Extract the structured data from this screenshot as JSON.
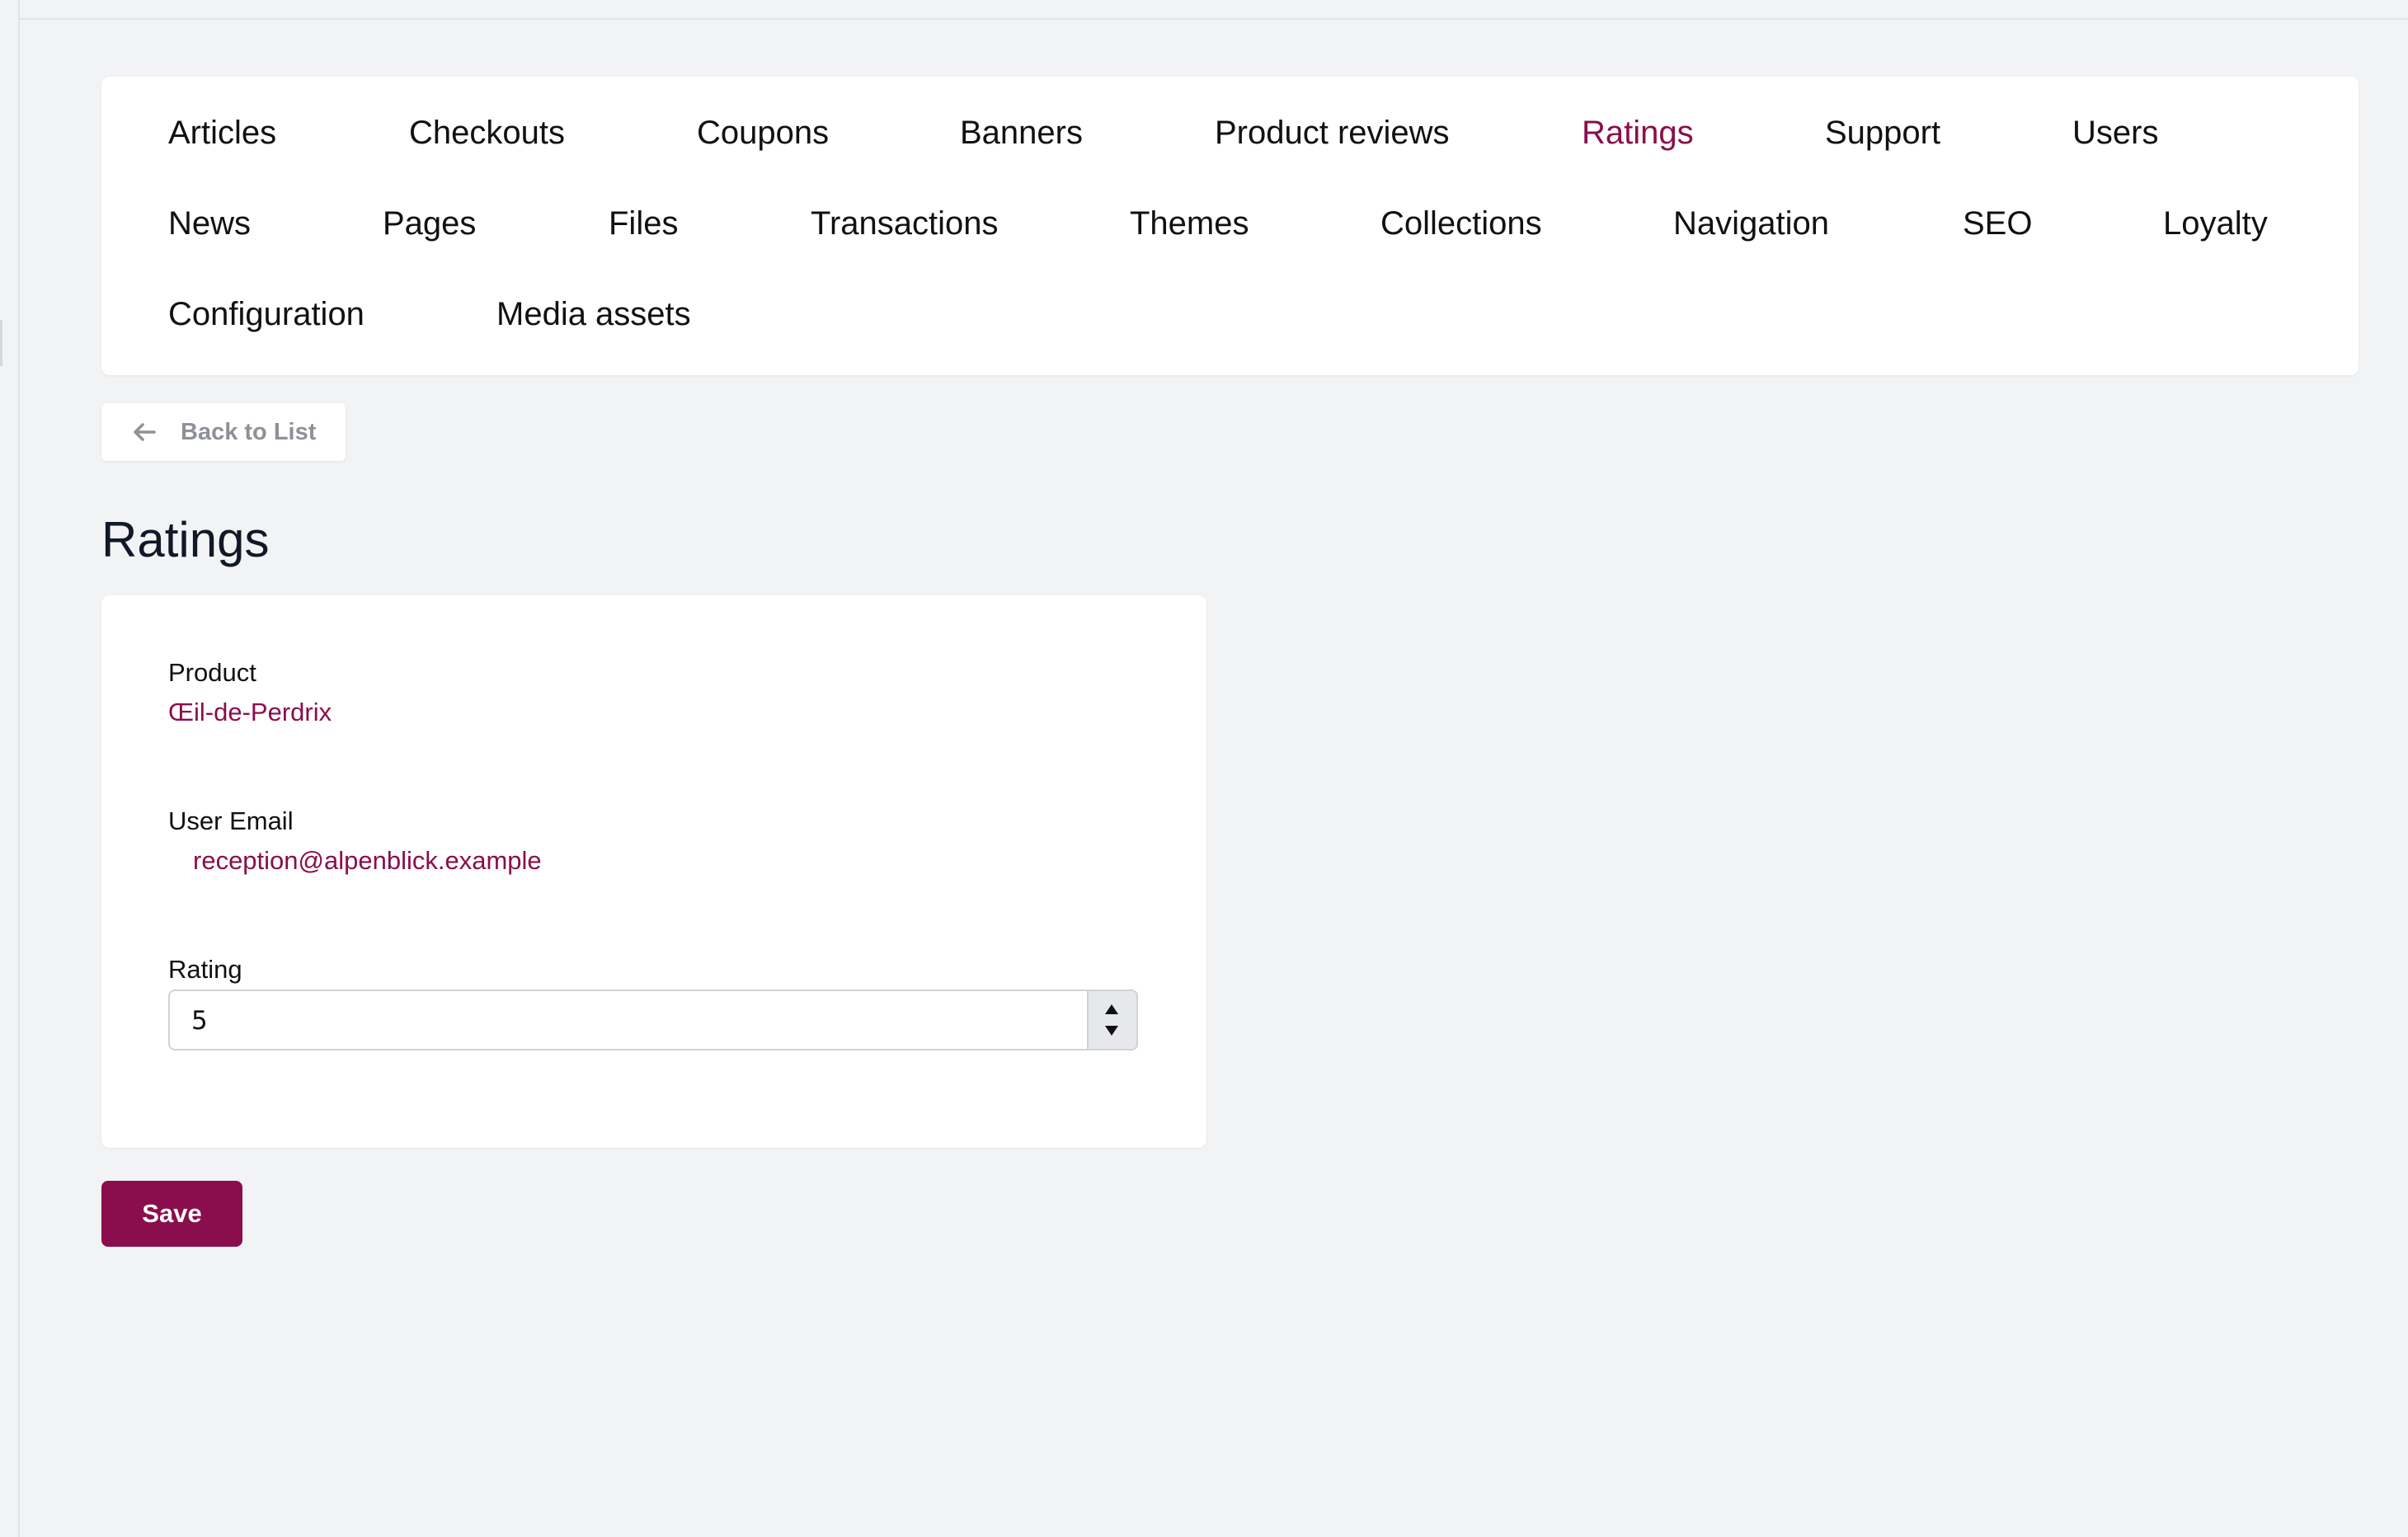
{
  "nav": {
    "active": "Ratings",
    "rows": [
      [
        "Articles",
        "Checkouts",
        "Coupons",
        "Banners",
        "Product reviews",
        "Ratings",
        "Support",
        "Users"
      ],
      [
        "News",
        "Pages",
        "Files",
        "Transactions",
        "Themes",
        "Collections",
        "Navigation",
        "SEO",
        "Loyalty"
      ],
      [
        "Configuration",
        "Media assets"
      ]
    ]
  },
  "back_button": {
    "label": "Back to List",
    "icon": "arrow-left-icon"
  },
  "page": {
    "title": "Ratings"
  },
  "form": {
    "product": {
      "label": "Product",
      "value": "Œil-de-Perdrix"
    },
    "user_email": {
      "label": "User Email",
      "value": "reception@alpenblick.example"
    },
    "rating": {
      "label": "Rating",
      "value": "5"
    }
  },
  "save_button": {
    "label": "Save"
  },
  "colors": {
    "accent": "#8a0e4d",
    "background": "#f2f3f5",
    "card": "#ffffff"
  }
}
